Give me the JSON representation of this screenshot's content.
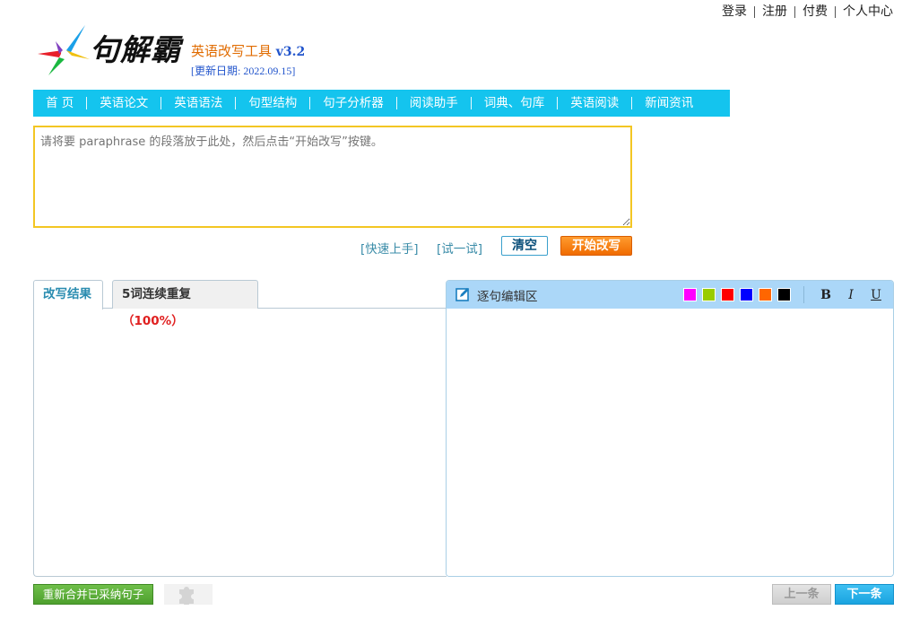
{
  "top_links": [
    "登录",
    "注册",
    "付费",
    "个人中心"
  ],
  "logo": {
    "brand": "句解霸",
    "product": "英语改写工具",
    "version": "v3.2",
    "update_date": "[更新日期: 2022.09.15]"
  },
  "nav": {
    "items": [
      "首 页",
      "英语论文",
      "英语语法",
      "句型结构",
      "句子分析器",
      "阅读助手",
      "词典、句库",
      "英语阅读",
      "新闻资讯"
    ]
  },
  "input": {
    "placeholder": "请将要 paraphrase 的段落放于此处，然后点击“开始改写”按键。",
    "value": ""
  },
  "actions": {
    "quick_start": "[快速上手]",
    "try_it": "[试一试]",
    "clear": "清空",
    "start": "开始改写"
  },
  "result_panel": {
    "tab_result": "改写结果",
    "tab_repeat": "5词连续重复",
    "tab_repeat_pct": "（100%）"
  },
  "edit_panel": {
    "title": "逐句编辑区",
    "icon": "edit-icon",
    "colors": [
      "#ff00ff",
      "#99cc00",
      "#ff0000",
      "#0000ff",
      "#ff6600",
      "#000000"
    ],
    "bold": "B",
    "italic": "I",
    "underline": "U"
  },
  "bottom": {
    "merge": "重新合并已采纳句子",
    "puzzle_icon": "puzzle-icon",
    "prev": "上一条",
    "next": "下一条"
  }
}
